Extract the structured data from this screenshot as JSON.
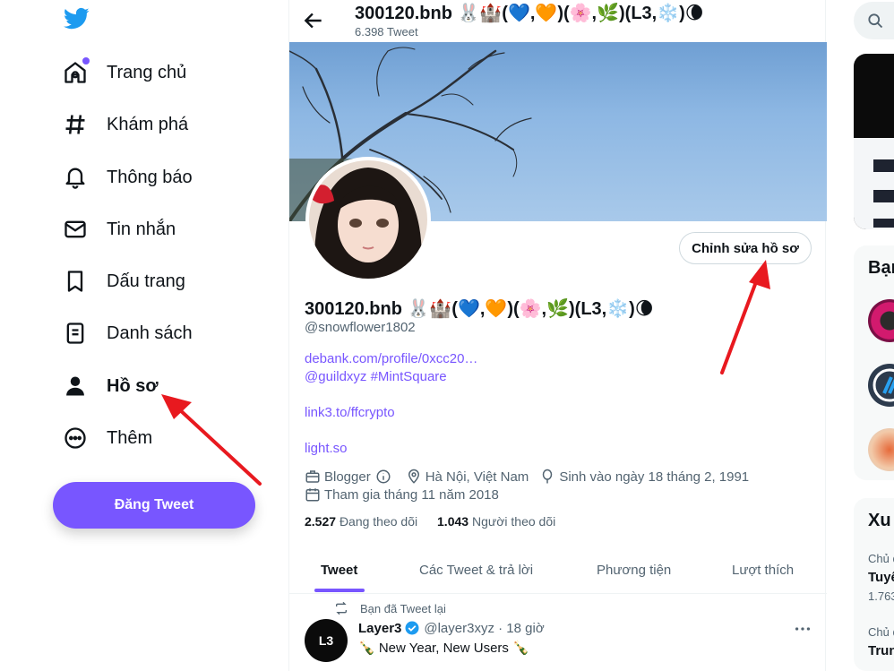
{
  "nav": {
    "items": [
      {
        "label": "Trang chủ",
        "icon": "home-icon"
      },
      {
        "label": "Khám phá",
        "icon": "hashtag-icon"
      },
      {
        "label": "Thông báo",
        "icon": "bell-icon"
      },
      {
        "label": "Tin nhắn",
        "icon": "mail-icon"
      },
      {
        "label": "Dấu trang",
        "icon": "bookmark-icon"
      },
      {
        "label": "Danh sách",
        "icon": "list-icon"
      },
      {
        "label": "Hồ sơ",
        "icon": "person-icon"
      },
      {
        "label": "Thêm",
        "icon": "more-circle-icon"
      }
    ],
    "tweet_button": "Đăng Tweet"
  },
  "header": {
    "name": "300120.bnb 🐰🏰(💙,🧡)(🌸,🌿)(L3,❄️)🌘",
    "tweet_count": "6.398 Tweet"
  },
  "profile": {
    "edit_button": "Chỉnh sửa hồ sơ",
    "name": "300120.bnb 🐰🏰(💙,🧡)(🌸,🌿)(L3,❄️)🌘",
    "handle": "@snowflower1802",
    "bio_links": [
      "debank.com/profile/0xcc20…",
      "@guildxyz #MintSquare",
      "link3.to/ffcrypto",
      "light.so"
    ],
    "category": "Blogger",
    "location": "Hà Nội, Việt Nam",
    "birthday": "Sinh vào ngày 18 tháng 2, 1991",
    "joined": "Tham gia tháng 11 năm 2018",
    "following_count": "2.527",
    "following_label": "Đang theo dõi",
    "followers_count": "1.043",
    "followers_label": "Người theo dõi"
  },
  "tabs": [
    "Tweet",
    "Các Tweet & trả lời",
    "Phương tiện",
    "Lượt thích"
  ],
  "tweet": {
    "retweet_label": "Bạn đã Tweet lại",
    "avatar_text": "L3",
    "author": "Layer3",
    "handle": "@layer3xyz · 18 giờ",
    "text": "🍾 New Year, New Users 🍾"
  },
  "right": {
    "card1_title": "Bạn",
    "card2_title": "Xu",
    "trend1_meta": "Chủ đ",
    "trend1_title": "Tuyể",
    "trend1_count": "1.763",
    "trend2_meta": "Chủ đ",
    "trend2_title": "Trun"
  },
  "colors": {
    "accent": "#7856ff",
    "annotation": "#e8191f",
    "secondary_text": "#536471"
  }
}
